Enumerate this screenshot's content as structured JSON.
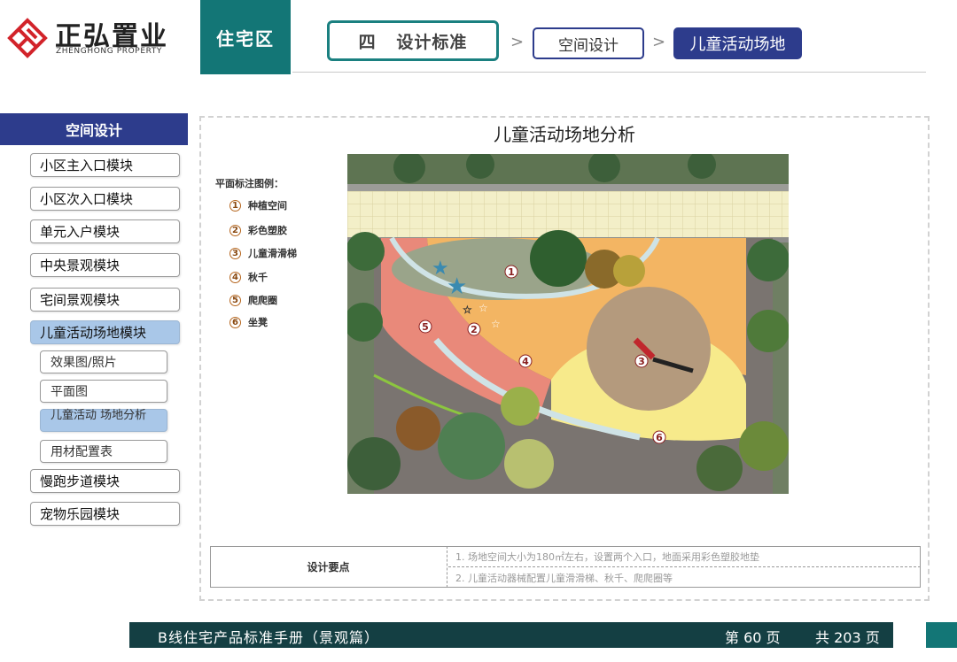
{
  "brand": {
    "name_cn": "正弘置业",
    "name_en": "ZHENGHONG PROPERTY"
  },
  "header": {
    "zone_tab": "住宅区",
    "breadcrumb": [
      "四   设计标准",
      "空间设计",
      "儿童活动场地"
    ],
    "separator": ">"
  },
  "sidebar": {
    "heading": "空间设计",
    "items": [
      "小区主入口模块",
      "小区次入口模块",
      "单元入户模块",
      "中央景观模块",
      "宅间景观模块",
      "儿童活动场地模块"
    ],
    "sub_items": [
      "效果图/照片",
      "平面图",
      "儿童活动 场地分析",
      "用材配置表"
    ],
    "items_after": [
      "慢跑步道模块",
      "宠物乐园模块"
    ]
  },
  "content": {
    "title": "儿童活动场地分析",
    "legend_title": "平面标注图例：",
    "legend": [
      {
        "num": "1",
        "label": "种植空间"
      },
      {
        "num": "2",
        "label": "彩色塑胶"
      },
      {
        "num": "3",
        "label": "儿童滑滑梯"
      },
      {
        "num": "4",
        "label": "秋千"
      },
      {
        "num": "5",
        "label": "爬爬圈"
      },
      {
        "num": "6",
        "label": "坐凳"
      }
    ],
    "design_points": {
      "label": "设计要点",
      "rows": [
        "1. 场地空间大小为180㎡左右，设置两个入口，地面采用彩色塑胶地垫",
        "2. 儿童活动器械配置儿童滑滑梯、秋千、爬爬圈等"
      ]
    }
  },
  "footer": {
    "title": "B线住宅产品标准手册（景观篇）",
    "page": "第 60 页",
    "total": "共 203 页"
  },
  "colors": {
    "teal": "#137676",
    "navy": "#2d3c8c",
    "active_item": "#a9c7e8",
    "footer": "#143f43",
    "logo_red": "#d2232a"
  }
}
